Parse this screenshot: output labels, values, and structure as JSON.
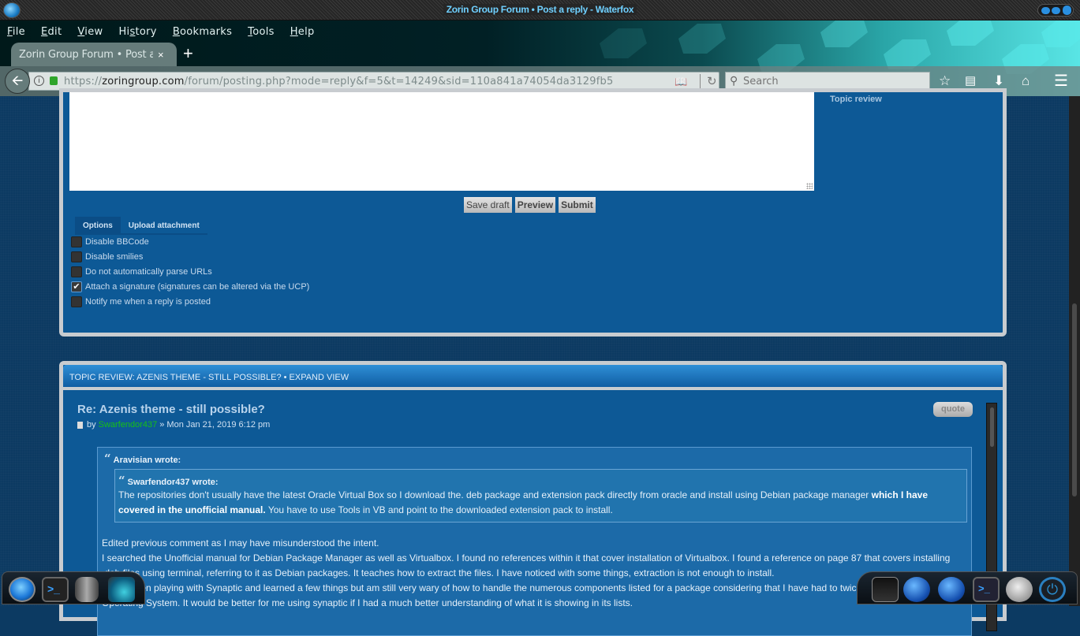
{
  "window": {
    "title": "Zorin Group Forum • Post a reply - Waterfox"
  },
  "menu": [
    {
      "label": "File",
      "accel": "F",
      "rest": "ile"
    },
    {
      "label": "Edit",
      "accel": "E",
      "rest": "dit"
    },
    {
      "label": "View",
      "accel": "V",
      "rest": "iew"
    },
    {
      "label": "History",
      "pre": "Hi",
      "accel": "s",
      "rest": "tory"
    },
    {
      "label": "Bookmarks",
      "accel": "B",
      "rest": "ookmarks"
    },
    {
      "label": "Tools",
      "accel": "T",
      "rest": "ools"
    },
    {
      "label": "Help",
      "accel": "H",
      "rest": "elp"
    }
  ],
  "tab": {
    "label": "Zorin Group Forum • Post a reply",
    "close": "×",
    "new": "+"
  },
  "nav": {
    "url_prefix": "https://",
    "url_domain": "zoringroup.com",
    "url_path": "/forum/posting.php?mode=reply&f=5&t=14249&sid=110a841a74054da3129fb5",
    "search_placeholder": "Search",
    "icons": [
      "back-icon",
      "info-icon",
      "lock-icon",
      "reader-view-icon",
      "reload-icon",
      "search-icon",
      "bookmark-star-icon",
      "clipboard-icon",
      "download-icon",
      "home-icon",
      "menu-icon"
    ]
  },
  "editor": {
    "topic_review_label": "Topic review",
    "buttons": {
      "save_draft": "Save draft",
      "preview": "Preview",
      "submit": "Submit"
    },
    "tabs": {
      "options": "Options",
      "upload": "Upload attachment"
    },
    "options": [
      {
        "label": "Disable BBCode",
        "checked": false
      },
      {
        "label": "Disable smilies",
        "checked": false
      },
      {
        "label": "Do not automatically parse URLs",
        "checked": false
      },
      {
        "label": "Attach a signature (signatures can be altered via the UCP)",
        "checked": true
      },
      {
        "label": "Notify me when a reply is posted",
        "checked": false
      }
    ]
  },
  "review": {
    "header": "TOPIC REVIEW: AZENIS THEME - STILL POSSIBLE? • EXPAND VIEW",
    "post": {
      "title": "Re: Azenis theme - still possible?",
      "by": "by",
      "author": "Swarfendor437",
      "date": "» Mon Jan 21, 2019 6:12 pm",
      "quote_button": "quote",
      "outer_cite": "Aravisian wrote:",
      "inner_cite": "Swarfendor437 wrote:",
      "inner_text_1": "The repositories don't usually have the latest Oracle Virtual Box so I download the. deb package and extension pack directly from oracle and install using Debian package manager ",
      "inner_bold_1": "which I have covered in the unofficial manual.",
      "inner_text_2": " You have to use Tools in VB and point to the downloaded extension pack to install.",
      "body_lines": [
        "Edited previous comment as I may have misunderstood the intent.",
        "I searched the Unofficial manual for Debian Package Manager as well as Virtualbox. I found no references within it that cover installation of Virtualbox. I found a reference on page 87 that covers installing",
        ".deb files using terminal, referring to it as Debian packages. It teaches how to extract the files. I have noticed with some things, extraction is not enough to install.",
        "I have been playing with Synaptic and learned a few things but am still very wary of how to handle the numerous components listed for a package considering that I have had to twice restore the Zorin",
        "Operating System. It would be better for me using synaptic if I had a much better understanding of what it is showing in its lists."
      ]
    }
  },
  "dock_left": [
    "web-browser-icon",
    "terminal-icon",
    "storage-icon",
    "network-icon"
  ],
  "dock_right": [
    "camera-icon",
    "internet-explorer-icon",
    "internet-explorer-icon",
    "terminal-icon",
    "moon-icon",
    "power-icon"
  ]
}
